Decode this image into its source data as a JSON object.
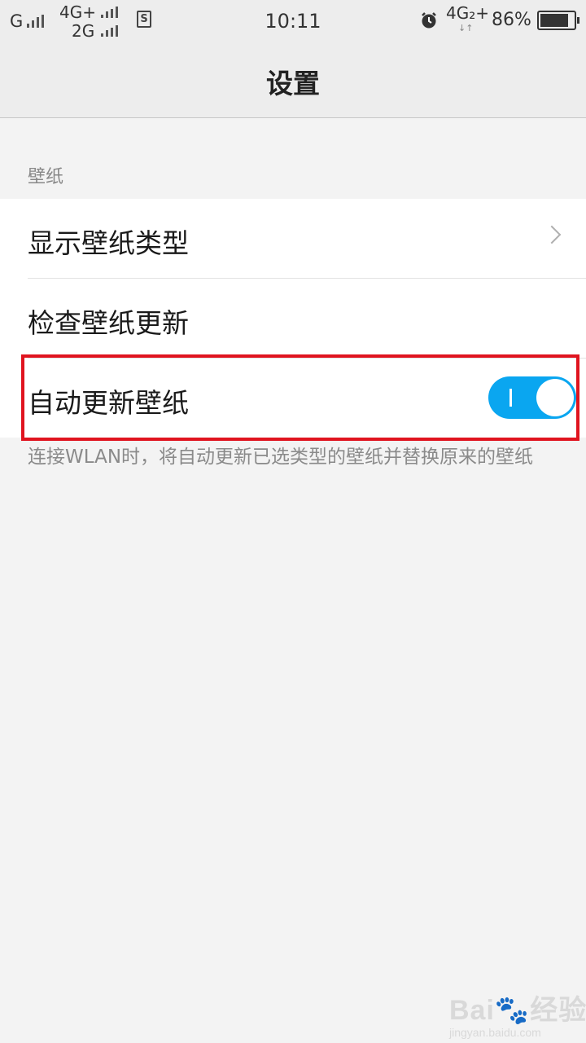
{
  "status_bar": {
    "carrier1": "G",
    "carrier2_top": "4G+",
    "carrier2_bottom": "2G",
    "sim_badge": "S",
    "time": "10:11",
    "network_right": "4G₂+",
    "battery_percent": "86%",
    "battery_level": 0.86,
    "icons": [
      "signal-icon",
      "sim-icon",
      "alarm-icon",
      "battery-icon"
    ]
  },
  "header": {
    "title": "设置"
  },
  "section": {
    "label": "壁纸"
  },
  "items": [
    {
      "label": "显示壁纸类型",
      "control": "chevron"
    },
    {
      "label": "检查壁纸更新",
      "control": "none"
    },
    {
      "label": "自动更新壁纸",
      "control": "toggle",
      "toggle_on": true
    }
  ],
  "description": "连接WLAN时，将自动更新已选类型的壁纸并替换原来的壁纸",
  "watermark": {
    "main": "Bai🐾经验",
    "sub": "jingyan.baidu.com"
  },
  "colors": {
    "toggle_on": "#0aa6f0",
    "highlight_border": "#e0141f",
    "background": "#f3f3f3"
  }
}
